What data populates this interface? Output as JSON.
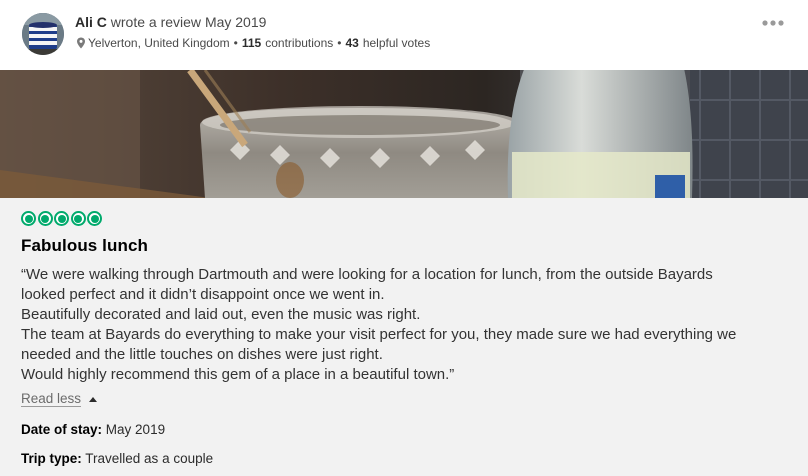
{
  "review": {
    "author": {
      "name": "Ali C",
      "action": "wrote a review",
      "date": "May 2019",
      "location": "Yelverton, United Kingdom",
      "contributions_count": "115",
      "contributions_label": "contributions",
      "helpful_count": "43",
      "helpful_label": "helpful votes",
      "separator": "•"
    },
    "more_label": "•••",
    "rating": {
      "value": 5,
      "max": 5
    },
    "title": "Fabulous lunch",
    "paragraphs": [
      "“We were walking through Dartmouth and were looking for a location for lunch, from the outside Bayards",
      "looked perfect and it didn’t disappoint once we went in.",
      "Beautifully decorated and laid out, even the music was right.",
      "The team at Bayards do everything to make your visit perfect for you, they made sure we had everything we",
      "needed and the little touches on dishes were just right.",
      "Would highly recommend this gem of a place in a beautiful town.”"
    ],
    "read_less_label": "Read less",
    "date_of_stay": {
      "label": "Date of stay:",
      "value": "May 2019"
    },
    "trip_type": {
      "label": "Trip type:",
      "value": "Travelled as a couple"
    }
  },
  "colors": {
    "rating_green": "#00aa6c",
    "body_background": "#f2f2f2"
  },
  "icons": {
    "location": "map-pin-icon",
    "more": "ellipsis-icon",
    "read_less": "caret-up-icon"
  }
}
